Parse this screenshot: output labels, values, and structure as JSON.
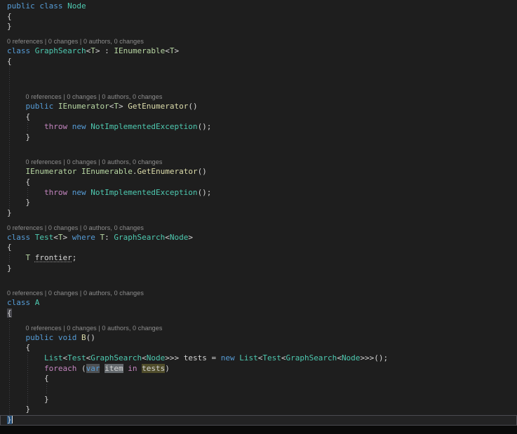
{
  "app": {
    "name": "code-editor",
    "theme": "dark"
  },
  "colors": {
    "bg": "#1e1e1e",
    "strip": "#0a0a0a",
    "keyword": "#569cd6",
    "control": "#c586c0",
    "type": "#4ec9b0",
    "type_param": "#b8d7a3",
    "plain": "#d4d4d4",
    "method": "#dcdcaa",
    "lens": "#8f8f8f",
    "hl_var": "#4e5154",
    "hl_item": "#656a6e",
    "hl_tests": "#504d2b",
    "brace_open": "#47474d",
    "brace_close": "#264f78",
    "current_line_border": "#4b4b50"
  },
  "editor": {
    "codelens_text": "0 references | 0 changes | 0 authors, 0 changes",
    "lines": [
      {
        "k": "c",
        "s": [
          [
            "public",
            "kw"
          ],
          [
            " "
          ],
          [
            "class",
            "kw"
          ],
          [
            " "
          ],
          [
            "Node",
            "ty"
          ]
        ]
      },
      {
        "k": "c",
        "s": [
          [
            "{"
          ]
        ]
      },
      {
        "k": "c",
        "s": [
          [
            "}"
          ]
        ]
      },
      {
        "k": "l",
        "ind": 0
      },
      {
        "k": "c",
        "s": [
          [
            "class",
            "kw"
          ],
          [
            " "
          ],
          [
            "GraphSearch",
            "ty"
          ],
          [
            "<"
          ],
          [
            "T",
            "tp"
          ],
          [
            ">"
          ],
          [
            " : "
          ],
          [
            "IEnumerable",
            "tp"
          ],
          [
            "<"
          ],
          [
            "T",
            "tp"
          ],
          [
            ">"
          ]
        ]
      },
      {
        "k": "c",
        "s": [
          [
            "{"
          ]
        ]
      },
      {
        "k": "b"
      },
      {
        "k": "b"
      },
      {
        "k": "l",
        "ind": 4
      },
      {
        "k": "c",
        "s": [
          [
            "    "
          ],
          [
            "public",
            "kw"
          ],
          [
            " "
          ],
          [
            "IEnumerator",
            "tp"
          ],
          [
            "<"
          ],
          [
            "T",
            "tp"
          ],
          [
            "> "
          ],
          [
            "GetEnumerator",
            "me"
          ],
          [
            "()"
          ]
        ]
      },
      {
        "k": "c",
        "s": [
          [
            "    {"
          ]
        ]
      },
      {
        "k": "c",
        "s": [
          [
            "        "
          ],
          [
            "throw",
            "ctrl"
          ],
          [
            " "
          ],
          [
            "new",
            "kw"
          ],
          [
            " "
          ],
          [
            "NotImplementedException",
            "ty"
          ],
          [
            "();"
          ]
        ]
      },
      {
        "k": "c",
        "s": [
          [
            "    }"
          ]
        ]
      },
      {
        "k": "b"
      },
      {
        "k": "l",
        "ind": 4
      },
      {
        "k": "c",
        "s": [
          [
            "    "
          ],
          [
            "IEnumerator",
            "tp"
          ],
          [
            " "
          ],
          [
            "IEnumerable",
            "tp"
          ],
          [
            "."
          ],
          [
            "GetEnumerator",
            "me"
          ],
          [
            "()"
          ]
        ]
      },
      {
        "k": "c",
        "s": [
          [
            "    {"
          ]
        ]
      },
      {
        "k": "c",
        "s": [
          [
            "        "
          ],
          [
            "throw",
            "ctrl"
          ],
          [
            " "
          ],
          [
            "new",
            "kw"
          ],
          [
            " "
          ],
          [
            "NotImplementedException",
            "ty"
          ],
          [
            "();"
          ]
        ]
      },
      {
        "k": "c",
        "s": [
          [
            "    }"
          ]
        ]
      },
      {
        "k": "c",
        "s": [
          [
            "}"
          ]
        ]
      },
      {
        "k": "l",
        "ind": 0
      },
      {
        "k": "c",
        "s": [
          [
            "class",
            "kw"
          ],
          [
            " "
          ],
          [
            "Test",
            "ty"
          ],
          [
            "<"
          ],
          [
            "T",
            "tp"
          ],
          [
            "> "
          ],
          [
            "where",
            "kw"
          ],
          [
            " "
          ],
          [
            "T",
            "tp"
          ],
          [
            ": "
          ],
          [
            "GraphSearch",
            "ty"
          ],
          [
            "<"
          ],
          [
            "Node",
            "ty"
          ],
          [
            ">"
          ]
        ]
      },
      {
        "k": "c",
        "s": [
          [
            "{"
          ]
        ]
      },
      {
        "k": "c",
        "s": [
          [
            "    "
          ],
          [
            "T",
            "tp"
          ],
          [
            " "
          ],
          [
            "frontier",
            "pl",
            "squiggle"
          ],
          [
            ";"
          ]
        ]
      },
      {
        "k": "c",
        "s": [
          [
            "}"
          ]
        ]
      },
      {
        "k": "b"
      },
      {
        "k": "l",
        "ind": 0
      },
      {
        "k": "c",
        "s": [
          [
            "class",
            "kw"
          ],
          [
            " "
          ],
          [
            "A",
            "ty"
          ]
        ]
      },
      {
        "k": "c",
        "s": [
          [
            "{",
            "pl",
            "brace-open"
          ]
        ]
      },
      {
        "k": "l",
        "ind": 4
      },
      {
        "k": "c",
        "s": [
          [
            "    "
          ],
          [
            "public",
            "kw"
          ],
          [
            " "
          ],
          [
            "void",
            "kw"
          ],
          [
            " "
          ],
          [
            "B",
            "me"
          ],
          [
            "()"
          ]
        ]
      },
      {
        "k": "c",
        "s": [
          [
            "    {"
          ]
        ]
      },
      {
        "k": "c",
        "s": [
          [
            "        "
          ],
          [
            "List",
            "ty"
          ],
          [
            "<"
          ],
          [
            "Test",
            "ty"
          ],
          [
            "<"
          ],
          [
            "GraphSearch",
            "ty"
          ],
          [
            "<"
          ],
          [
            "Node",
            "ty"
          ],
          [
            ">>> tests = "
          ],
          [
            "new",
            "kw"
          ],
          [
            " "
          ],
          [
            "List",
            "ty"
          ],
          [
            "<"
          ],
          [
            "Test",
            "ty"
          ],
          [
            "<"
          ],
          [
            "GraphSearch",
            "ty"
          ],
          [
            "<"
          ],
          [
            "Node",
            "ty"
          ],
          [
            ">>>();"
          ]
        ]
      },
      {
        "k": "c",
        "s": [
          [
            "        "
          ],
          [
            "foreach",
            "ctrl"
          ],
          [
            " ("
          ],
          [
            "var",
            "kw",
            "hl-var"
          ],
          [
            " "
          ],
          [
            "item",
            "pl",
            "hl-item"
          ],
          [
            " "
          ],
          [
            "in",
            "ctrl"
          ],
          [
            " "
          ],
          [
            "tests",
            "pl",
            "hl-tests"
          ],
          [
            ")"
          ]
        ]
      },
      {
        "k": "c",
        "s": [
          [
            "        {"
          ]
        ]
      },
      {
        "k": "b"
      },
      {
        "k": "c",
        "s": [
          [
            "        }"
          ]
        ]
      },
      {
        "k": "c",
        "s": [
          [
            "    }"
          ]
        ]
      },
      {
        "k": "c",
        "cur": true,
        "s": [
          [
            "}",
            "pl",
            "brace-close"
          ]
        ]
      }
    ]
  }
}
